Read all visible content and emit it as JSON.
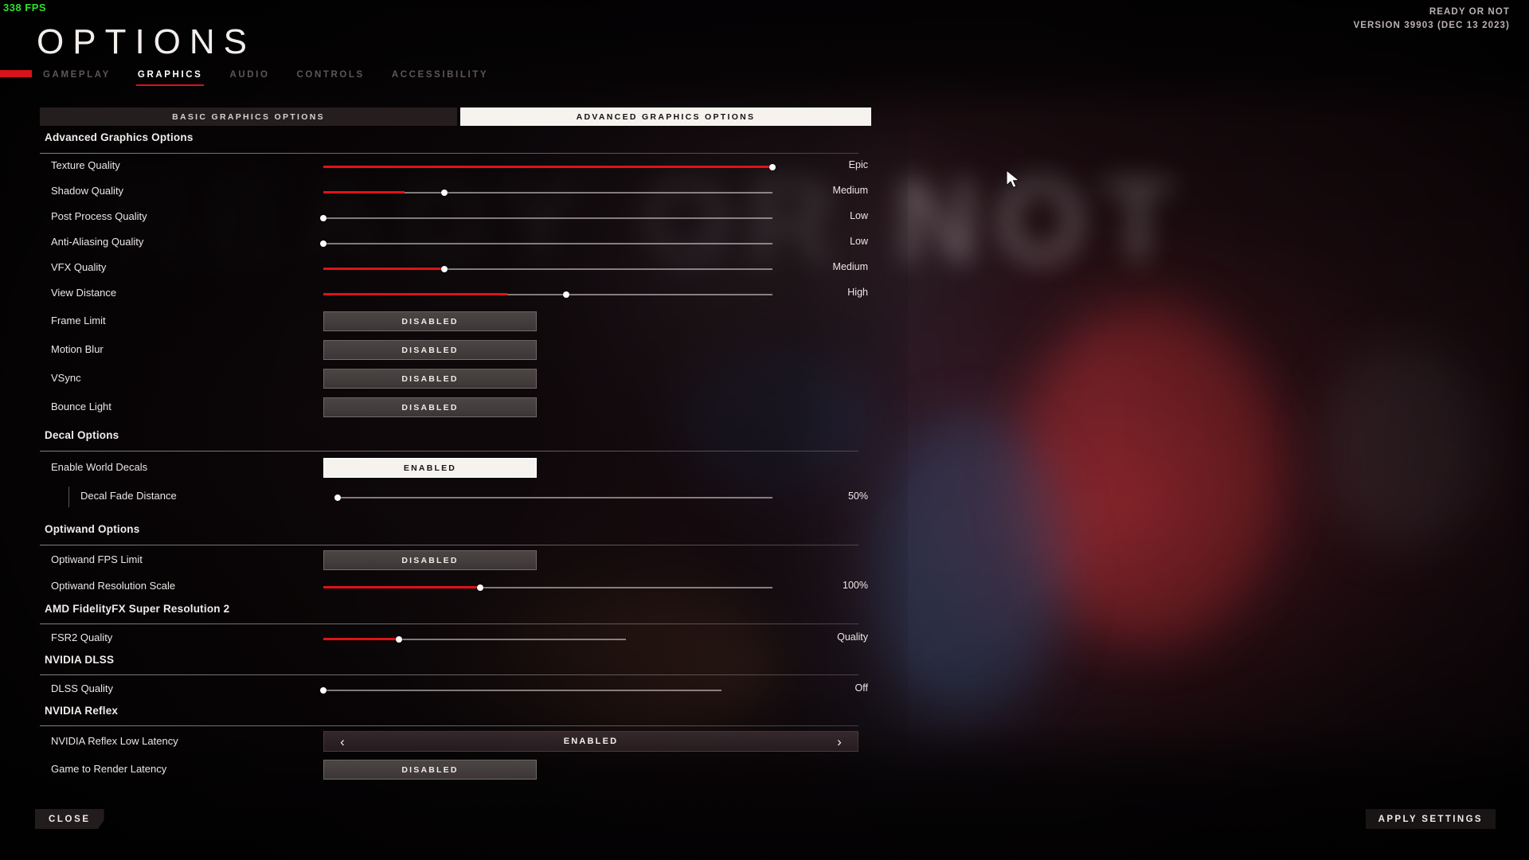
{
  "hud": {
    "fps": "338 FPS",
    "game_title": "READY OR NOT",
    "version": "VERSION 39903 (DEC 13 2023)"
  },
  "header": {
    "title": "OPTIONS",
    "accent_color": "#d8131a"
  },
  "main_tabs": [
    {
      "label": "GAMEPLAY",
      "active": false
    },
    {
      "label": "GRAPHICS",
      "active": true
    },
    {
      "label": "AUDIO",
      "active": false
    },
    {
      "label": "CONTROLS",
      "active": false
    },
    {
      "label": "ACCESSIBILITY",
      "active": false
    }
  ],
  "sub_tabs": [
    {
      "label": "BASIC GRAPHICS OPTIONS",
      "active": false
    },
    {
      "label": "ADVANCED GRAPHICS OPTIONS",
      "active": true
    }
  ],
  "sections": {
    "advanced": {
      "header": "Advanced Graphics Options",
      "rows": {
        "texture_quality": {
          "name": "Texture Quality",
          "value": "Epic",
          "percent": 100
        },
        "shadow_quality": {
          "name": "Shadow Quality",
          "value": "Medium",
          "percent": 27
        },
        "post_process": {
          "name": "Post Process Quality",
          "value": "Low",
          "percent": 0
        },
        "anti_aliasing": {
          "name": "Anti-Aliasing Quality",
          "value": "Low",
          "percent": 0
        },
        "vfx_quality": {
          "name": "VFX Quality",
          "value": "Medium",
          "percent": 27
        },
        "view_distance": {
          "name": "View Distance",
          "value": "High",
          "percent": 54
        },
        "frame_limit": {
          "name": "Frame Limit",
          "value": "DISABLED"
        },
        "motion_blur": {
          "name": "Motion Blur",
          "value": "DISABLED"
        },
        "vsync": {
          "name": "VSync",
          "value": "DISABLED"
        },
        "bounce_light": {
          "name": "Bounce Light",
          "value": "DISABLED"
        }
      }
    },
    "decal": {
      "header": "Decal Options",
      "rows": {
        "enable_world_decals": {
          "name": "Enable World Decals",
          "value": "ENABLED"
        },
        "decal_fade_distance": {
          "name": "Decal Fade Distance",
          "value": "50%",
          "percent": 3
        }
      }
    },
    "optiwand": {
      "header": "Optiwand Options",
      "rows": {
        "optiwand_fps_limit": {
          "name": "Optiwand FPS Limit",
          "value": "DISABLED"
        },
        "optiwand_res_scale": {
          "name": "Optiwand Resolution Scale",
          "value": "100%",
          "percent": 35
        }
      }
    },
    "fsr": {
      "header": "AMD FidelityFX Super Resolution 2",
      "rows": {
        "fsr2_quality": {
          "name": "FSR2 Quality",
          "value": "Quality",
          "percent": 25
        }
      }
    },
    "dlss": {
      "header": "NVIDIA DLSS",
      "rows": {
        "dlss_quality": {
          "name": "DLSS Quality",
          "value": "Off",
          "percent": 0
        }
      }
    },
    "reflex": {
      "header": "NVIDIA Reflex",
      "rows": {
        "reflex_low_latency": {
          "name": "NVIDIA Reflex Low Latency",
          "value": "ENABLED",
          "prev": "‹",
          "next": "›"
        },
        "game_to_render_latency": {
          "name": "Game to Render Latency",
          "value": "DISABLED"
        }
      }
    }
  },
  "footer": {
    "close": "CLOSE",
    "apply": "APPLY SETTINGS"
  }
}
